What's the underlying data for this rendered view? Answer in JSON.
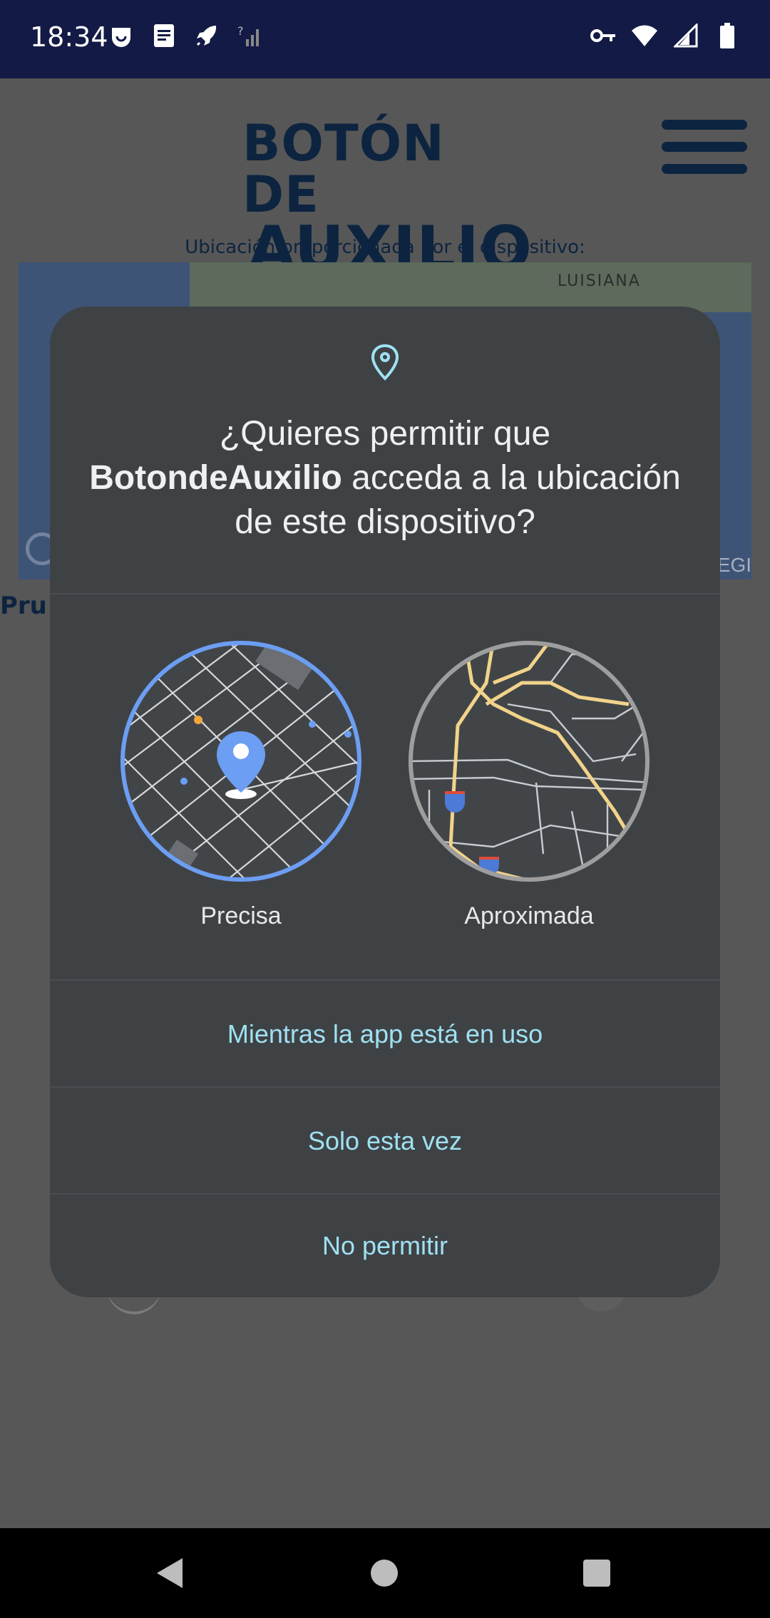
{
  "status_bar": {
    "time": "18:34",
    "left_icons": [
      "smile-notification-icon",
      "document-icon",
      "rocket-icon",
      "no-signal-icon"
    ],
    "right_icons": [
      "vpn-key-icon",
      "wifi-icon",
      "cell-signal-icon",
      "battery-icon"
    ]
  },
  "app": {
    "logo_line1": "BOTÓN DE",
    "logo_line2": "AUXILIO",
    "location_caption": "Ubicación proporcionada por el dispositivo:",
    "map_label": "LUISIANA",
    "map_attribution_partial": "EGI",
    "partial_text": "Pru"
  },
  "dialog": {
    "title_prefix": "¿Quieres permitir que",
    "app_name": "BotondeAuxilio",
    "title_suffix": " acceda a la ubicación de este dispositivo?",
    "precise_label": "Precisa",
    "approx_label": "Aproximada",
    "buttons": {
      "while_in_use": "Mientras la app está en uso",
      "only_this_time": "Solo esta vez",
      "deny": "No permitir"
    }
  },
  "colors": {
    "status_bar_bg": "#131a45",
    "dialog_bg": "#3f4245",
    "button_text": "#9fe1f2",
    "precise_ring": "#6c9ef3",
    "approx_ring": "#9e9e9e",
    "logo": "#0d2440"
  }
}
